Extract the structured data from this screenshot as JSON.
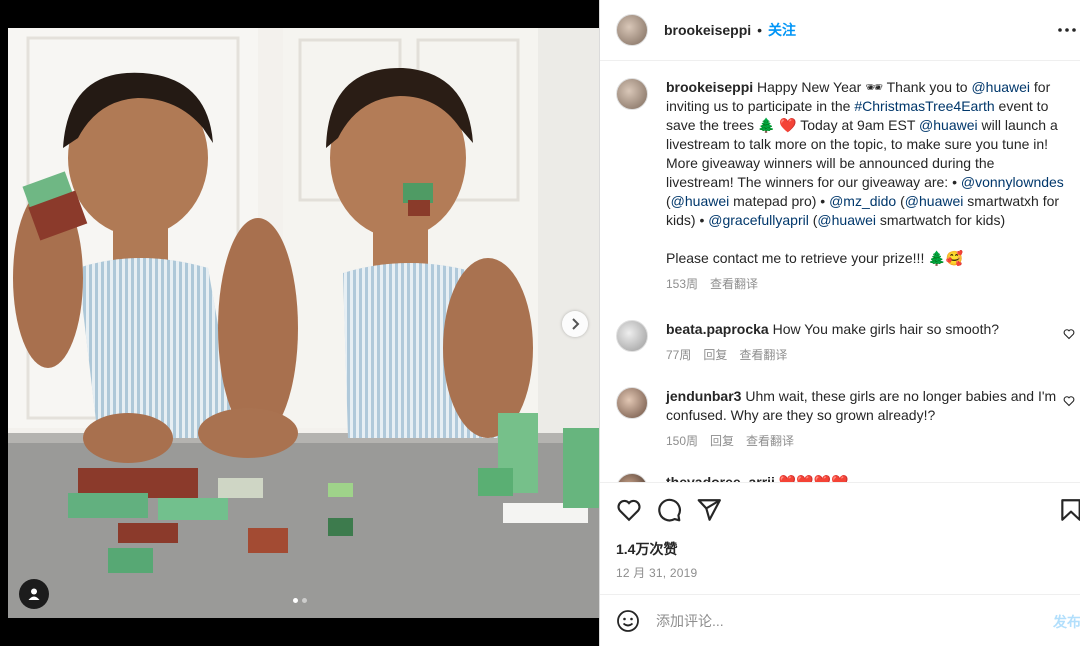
{
  "post": {
    "username": "brookeiseppi",
    "separator": "•",
    "follow_label": "关注",
    "caption": {
      "parts": [
        {
          "t": "Happy New Year 🕶 Thank you to ",
          "k": "text"
        },
        {
          "t": "@huawei",
          "k": "link"
        },
        {
          "t": " for inviting us to participate in the ",
          "k": "text"
        },
        {
          "t": "#ChristmasTree4Earth",
          "k": "link"
        },
        {
          "t": " event to save the trees 🌲 ❤️ Today at 9am EST ",
          "k": "text"
        },
        {
          "t": "@huawei",
          "k": "link"
        },
        {
          "t": " will launch a livestream to talk more on the topic, to make sure you tune in! More giveaway winners will be announced during the livestream! The winners for our giveaway are: • ",
          "k": "text"
        },
        {
          "t": "@vonnylowndes",
          "k": "link"
        },
        {
          "t": " (",
          "k": "text"
        },
        {
          "t": "@huawei",
          "k": "link"
        },
        {
          "t": " matepad pro) • ",
          "k": "text"
        },
        {
          "t": "@mz_dido",
          "k": "link"
        },
        {
          "t": " (",
          "k": "text"
        },
        {
          "t": "@huawei",
          "k": "link"
        },
        {
          "t": " smartwatxh for kids) • ",
          "k": "text"
        },
        {
          "t": "@gracefullyapril",
          "k": "link"
        },
        {
          "t": " (",
          "k": "text"
        },
        {
          "t": "@huawei",
          "k": "link"
        },
        {
          "t": " smartwatch for kids)",
          "k": "text"
        }
      ],
      "closing": "Please contact me to retrieve your prize!!! 🌲🥰",
      "time": "153周",
      "translate": "查看翻译"
    },
    "likes": "1.4万次赞",
    "date": "12 月 31, 2019"
  },
  "comments": [
    {
      "user": "beata.paprocka",
      "text": "How You make girls hair so smooth?",
      "time": "77周",
      "reply": "回复",
      "translate": "查看翻译"
    },
    {
      "user": "jendunbar3",
      "text": "Uhm wait, these girls are no longer babies and I'm confused. Why are they so grown already!?",
      "time": "150周",
      "reply": "回复",
      "translate": "查看翻译"
    },
    {
      "user": "thevadoree_arrii",
      "text": "❤️❤️❤️❤️",
      "time": "",
      "reply": "",
      "translate": ""
    }
  ],
  "composer": {
    "placeholder": "添加评论...",
    "post_label": "发布"
  },
  "icons": {
    "more": "more-horizontal-icon",
    "like": "heart-icon",
    "comment": "comment-bubble-icon",
    "share": "paper-plane-icon",
    "save": "bookmark-icon",
    "emoji": "smiley-icon",
    "next": "chevron-right-icon",
    "tag": "user-tag-icon"
  },
  "colors": {
    "link": "#00376b",
    "follow": "#0095f6",
    "muted": "#8e8e8e"
  }
}
